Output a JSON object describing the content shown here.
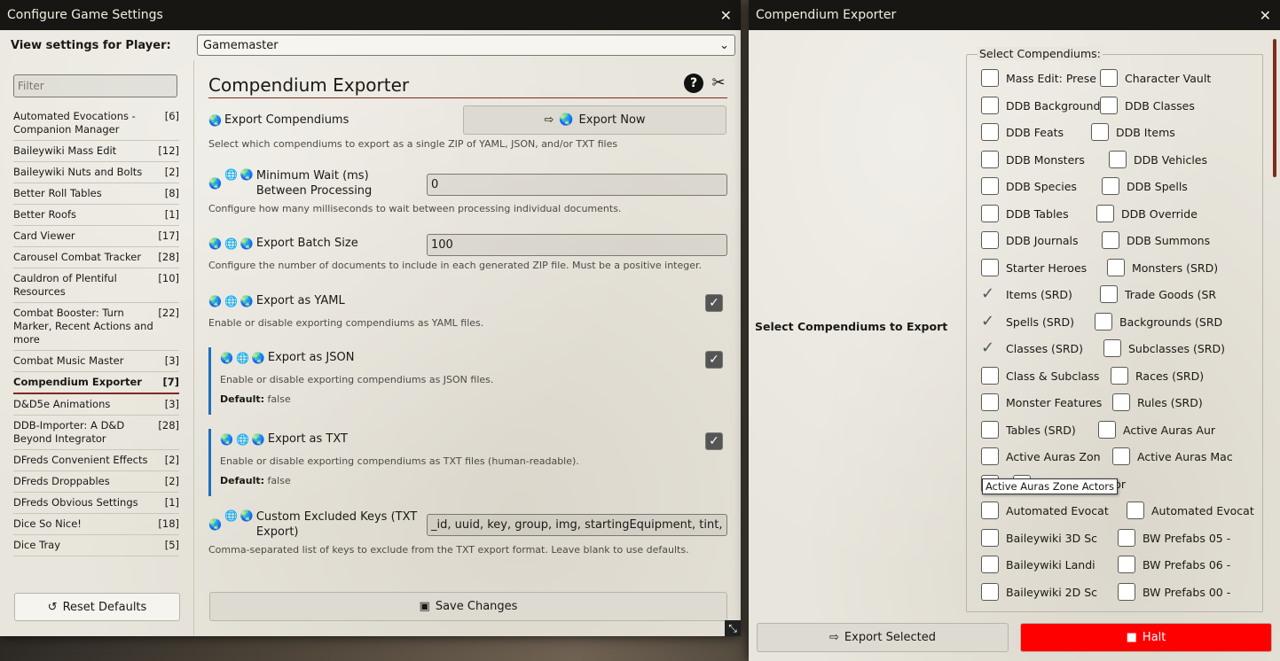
{
  "settings_window": {
    "title": "Configure Game Settings",
    "close_icon": "close-icon",
    "player_label": "View settings for Player:",
    "player_value": "Gamemaster",
    "filter_placeholder": "Filter",
    "nav": [
      {
        "label": "Automated Evocations - Companion Manager",
        "count": "[6]"
      },
      {
        "label": "Baileywiki Mass Edit",
        "count": "[12]"
      },
      {
        "label": "Baileywiki Nuts and Bolts",
        "count": "[2]"
      },
      {
        "label": "Better Roll Tables",
        "count": "[8]"
      },
      {
        "label": "Better Roofs",
        "count": "[1]"
      },
      {
        "label": "Card Viewer",
        "count": "[17]"
      },
      {
        "label": "Carousel Combat Tracker",
        "count": "[28]"
      },
      {
        "label": "Cauldron of Plentiful Resources",
        "count": "[10]"
      },
      {
        "label": "Combat Booster: Turn Marker, Recent Actions and more",
        "count": "[22]"
      },
      {
        "label": "Combat Music Master",
        "count": "[3]"
      },
      {
        "label": "Compendium Exporter",
        "count": "[7]"
      },
      {
        "label": "D&D5e Animations",
        "count": "[3]"
      },
      {
        "label": "DDB-Importer: A D&D Beyond Integrator",
        "count": "[28]"
      },
      {
        "label": "DFreds Convenient Effects",
        "count": "[2]"
      },
      {
        "label": "DFreds Droppables",
        "count": "[2]"
      },
      {
        "label": "DFreds Obvious Settings",
        "count": "[1]"
      },
      {
        "label": "Dice So Nice!",
        "count": "[18]"
      },
      {
        "label": "Dice Tray",
        "count": "[5]"
      }
    ],
    "reset_label": "Reset Defaults",
    "module_title": "Compendium Exporter",
    "export_compendiums_label": "Export Compendiums",
    "export_now_label": "Export Now",
    "export_compendiums_hint": "Select which compendiums to export as a single ZIP of YAML, JSON, and/or TXT files",
    "min_wait_label": "Minimum Wait (ms) Between Processing",
    "min_wait_value": "0",
    "min_wait_hint": "Configure how many milliseconds to wait between processing individual documents.",
    "batch_label": "Export Batch Size",
    "batch_value": "100",
    "batch_hint": "Configure the number of documents to include in each generated ZIP file. Must be a positive integer.",
    "yaml_label": "Export as YAML",
    "yaml_hint": "Enable or disable exporting compendiums as YAML files.",
    "json_label": "Export as JSON",
    "json_hint": "Enable or disable exporting compendiums as JSON files.",
    "json_default_key": "Default:",
    "json_default_val": " false",
    "txt_label": "Export as TXT",
    "txt_hint": "Enable or disable exporting compendiums as TXT files (human-readable).",
    "txt_default_key": "Default:",
    "txt_default_val": " false",
    "keys_label": "Custom Excluded Keys (TXT Export)",
    "keys_value": "_id, uuid, key, group, img, startingEquipment, tint, chris",
    "keys_hint": "Comma-separated list of keys to exclude from the TXT export format. Leave blank to use defaults.",
    "save_label": "Save Changes"
  },
  "exporter_window": {
    "title": "Compendium Exporter",
    "select_label": "Select Compendiums to Export",
    "legend": "Select Compendiums:",
    "tooltip": "Active Auras Zone Actors",
    "export_selected": "Export Selected",
    "halt": "Halt",
    "rows": [
      [
        {
          "label": "Mass Edit: Prese",
          "checked": false
        },
        {
          "label": "Character Vault",
          "checked": false
        }
      ],
      [
        {
          "label": "DDB Backgrounds",
          "checked": false
        },
        {
          "label": "DDB Classes",
          "checked": false
        }
      ],
      [
        {
          "label": "DDB Feats",
          "checked": false
        },
        {
          "label": "DDB Items",
          "checked": false
        }
      ],
      [
        {
          "label": "DDB Monsters",
          "checked": false
        },
        {
          "label": "DDB Vehicles",
          "checked": false
        }
      ],
      [
        {
          "label": "DDB Species",
          "checked": false
        },
        {
          "label": "DDB Spells",
          "checked": false
        }
      ],
      [
        {
          "label": "DDB Tables",
          "checked": false
        },
        {
          "label": "DDB Override",
          "checked": false
        }
      ],
      [
        {
          "label": "DDB Journals",
          "checked": false
        },
        {
          "label": "DDB Summons",
          "checked": false
        }
      ],
      [
        {
          "label": "Starter Heroes",
          "checked": false
        },
        {
          "label": "Monsters (SRD)",
          "checked": false
        }
      ],
      [
        {
          "label": "Items (SRD)",
          "checked": true
        },
        {
          "label": "Trade Goods (SR",
          "checked": false
        }
      ],
      [
        {
          "label": "Spells (SRD)",
          "checked": true
        },
        {
          "label": "Backgrounds (SRD",
          "checked": false
        }
      ],
      [
        {
          "label": "Classes (SRD)",
          "checked": true
        },
        {
          "label": "Subclasses (SRD)",
          "checked": false
        }
      ],
      [
        {
          "label": "Class & Subclass",
          "checked": false
        },
        {
          "label": "Races (SRD)",
          "checked": false
        }
      ],
      [
        {
          "label": "Monster Features",
          "checked": false
        },
        {
          "label": "Rules (SRD)",
          "checked": false
        }
      ],
      [
        {
          "label": "Tables (SRD)",
          "checked": false
        },
        {
          "label": "Active Auras Aur",
          "checked": false
        }
      ],
      [
        {
          "label": "Active Auras Zon",
          "checked": false
        },
        {
          "label": "Active Auras Mac",
          "checked": false
        }
      ],
      [
        {
          "label": "",
          "checked": false
        },
        {
          "label": "Token Effects pr",
          "checked": false
        }
      ],
      [
        {
          "label": "Automated Evocat",
          "checked": false
        },
        {
          "label": "Automated Evocat",
          "checked": false
        }
      ],
      [
        {
          "label": "Baileywiki 3D Sc",
          "checked": false
        },
        {
          "label": "BW Prefabs 05 -",
          "checked": false
        }
      ],
      [
        {
          "label": "Baileywiki Landi",
          "checked": false
        },
        {
          "label": "BW Prefabs 06 -",
          "checked": false
        }
      ],
      [
        {
          "label": "Baileywiki 2D Sc",
          "checked": false
        },
        {
          "label": "BW Prefabs 00 -",
          "checked": false
        }
      ]
    ]
  },
  "colors": {
    "accent": "#7c2c1e",
    "halt": "#ff0000",
    "header": "#171613",
    "indent_bar": "#1d6fbf"
  }
}
